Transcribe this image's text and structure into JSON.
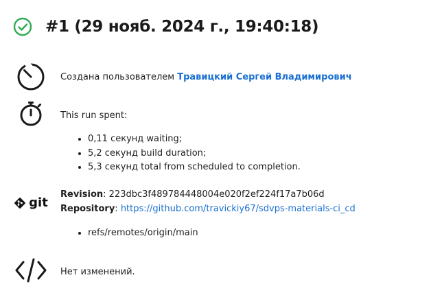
{
  "header": {
    "title": "#1 (29 нояб. 2024 г., 19:40:18)",
    "status_icon": "check-circle-icon",
    "status_color": "#2eaa52"
  },
  "started_by": {
    "icon": "gauge-icon",
    "prefix": "Создана пользователем ",
    "user_name": "Травицкий Сергей Владимирович"
  },
  "timing": {
    "icon": "stopwatch-icon",
    "heading": "This run spent:",
    "items": [
      "0,11 секунд waiting;",
      "5,2 секунд build duration;",
      "5,3 секунд total from scheduled to completion."
    ]
  },
  "git": {
    "icon": "git-logo-icon",
    "logo_text": "git",
    "revision_label": "Revision",
    "revision_value": "223dbc3f489784448004e020f2ef224f17a7b06d",
    "repository_label": "Repository",
    "repository_url": "https://github.com/travickiy67/sdvps-materials-ci_cd",
    "branches": [
      "refs/remotes/origin/main"
    ]
  },
  "changes": {
    "icon": "code-icon",
    "text": "Нет изменений."
  },
  "colors": {
    "link": "#1a6fd1",
    "text": "#1f1f1f",
    "success": "#2eaa52"
  }
}
